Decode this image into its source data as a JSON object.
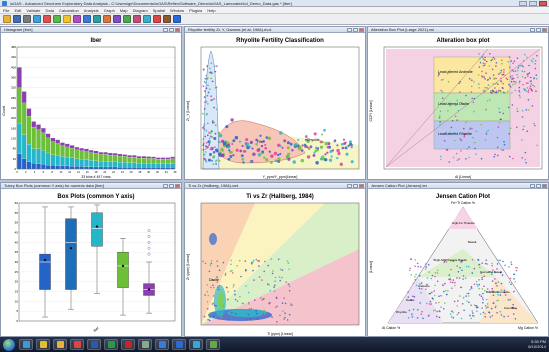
{
  "app": {
    "title": "ioGAS - Advanced Geochem Exploratory Data Analysis - C:\\Users\\ge\\Documents\\ioGAS\\Reflex\\Software_Demo\\ioGAS_Lamorales\\Iol_Demo_Data.gas * [Iber]",
    "menu": [
      "File",
      "Edit",
      "Validate",
      "Data",
      "Calculation",
      "Analysis",
      "Graph",
      "Map",
      "Diagram",
      "Spatial",
      "Window",
      "Plugins",
      "Help"
    ]
  },
  "toolbar": {
    "buttons": [
      {
        "name": "open-icon",
        "color": "#e8b23a"
      },
      {
        "name": "save-icon",
        "color": "#3f6fb5"
      },
      {
        "name": "print-icon",
        "color": "#7a7a7a"
      },
      {
        "name": "table-icon",
        "color": "#3aa0d8"
      },
      {
        "name": "attributes-icon",
        "color": "#e05050"
      },
      {
        "name": "color-icon",
        "color": "#59b84a"
      },
      {
        "name": "shape-icon",
        "color": "#f1c232"
      },
      {
        "name": "size-icon",
        "color": "#b04fc0"
      },
      {
        "name": "histogram-icon",
        "color": "#3a7ad8"
      },
      {
        "name": "scatter-icon",
        "color": "#2aa0a0"
      },
      {
        "name": "boxplot-icon",
        "color": "#d8783a"
      },
      {
        "name": "ternary-icon",
        "color": "#7d4fc0"
      },
      {
        "name": "map-icon",
        "color": "#4fa84f"
      },
      {
        "name": "spider-icon",
        "color": "#c04f7a"
      },
      {
        "name": "diagram-icon",
        "color": "#3ab0c8"
      },
      {
        "name": "probability-icon",
        "color": "#d44"
      },
      {
        "name": "summary-icon",
        "color": "#8a5a2a"
      },
      {
        "name": "info-icon",
        "color": "#2a6ad8"
      }
    ]
  },
  "windows": {
    "histogram": {
      "title": "Histogram [Iber]",
      "chart_title": "Iber",
      "xlabel": "33 bins # 497 rows",
      "ylabel": "Count"
    },
    "rhyolite": {
      "title": "Rhyolite fertility Zr, Y, Gamma (et al, 1984).ev.d",
      "chart_title": "Rhyolite Fertility Classification",
      "xlabel": "Y_ppm/Y_ppm[Linear]",
      "ylabel": "Zr_Y [Linear]",
      "region_label": "Fife",
      "series_label": "Rhyolite"
    },
    "alteration": {
      "title": "Alteration Box Plot (Large 2021).vsl",
      "chart_title": "Alteration box plot",
      "xlabel": "AI [Linear]",
      "ylabel": "CCPI [Linear]",
      "zone_labels": [
        "Least altered Andesite",
        "Least altered Dacite",
        "Least altered Rhyolite"
      ]
    },
    "boxplot": {
      "title": "Tukey Box Plots (common Y axis) for numeric data [Iber]",
      "chart_title": "Box Plots (common Y axis)",
      "category": "Iber"
    },
    "tizr": {
      "title": "Ti vs Zr (Hallberg, 1984).vml",
      "chart_title": "Ti vs Zr (Hallberg, 1984)",
      "xlabel": "Ti (ppm) [Linear]",
      "ylabel": "Zr (ppm) [Linear]",
      "region_label": "Dacite"
    },
    "jensen": {
      "title": "Jensen Cation Plot (Jensen).ter",
      "chart_title": "Jensen Cation Plot",
      "apex_top": "Fe+Ti Cation %",
      "apex_left": "Al Cation %",
      "apex_right": "Mg Cation %",
      "ylabel": "[Linear]",
      "fields": [
        "High-Fe Tholeiite",
        "Basalt",
        "High-Mg Tholeiite Basalt",
        "Andesite",
        "Komatiitic Basalt",
        "Dacite",
        "Basaltic Komatiite",
        "Rhyolite",
        "Komatiite"
      ]
    }
  },
  "chart_data": [
    {
      "type": "bar",
      "name": "histogram",
      "title": "Iber",
      "xlabel": "33 bins # 497 rows",
      "ylabel": "Count",
      "ylim": [
        0,
        480
      ],
      "yticks": [
        0,
        40,
        80,
        120,
        160,
        200,
        240,
        280,
        320,
        360,
        400,
        440,
        480
      ],
      "xticks": [
        "0",
        "2",
        "4",
        "6",
        "8",
        "10",
        "12",
        "14",
        "16",
        "18",
        "20",
        "22",
        "24",
        "26",
        "28",
        "30",
        "32",
        "34",
        "36"
      ],
      "series": [
        {
          "name": "blue",
          "color": "#2563c9",
          "values": [
            60,
            40,
            28,
            22,
            20,
            18,
            15,
            14,
            13,
            12,
            12,
            11,
            10,
            10,
            9,
            9,
            8,
            8,
            8,
            8,
            8,
            7,
            7,
            7,
            7,
            6,
            6,
            6,
            6,
            6,
            6,
            6,
            6
          ]
        },
        {
          "name": "teal",
          "color": "#27b6c9",
          "values": [
            120,
            95,
            70,
            58,
            60,
            55,
            48,
            42,
            40,
            38,
            35,
            33,
            30,
            28,
            28,
            26,
            24,
            22,
            22,
            21,
            20,
            20,
            19,
            18,
            18,
            17,
            17,
            16,
            16,
            15,
            15,
            15,
            15
          ]
        },
        {
          "name": "green",
          "color": "#6dbf3a",
          "values": [
            140,
            125,
            110,
            85,
            75,
            70,
            60,
            52,
            48,
            42,
            40,
            38,
            36,
            34,
            32,
            30,
            30,
            28,
            28,
            26,
            26,
            24,
            24,
            22,
            22,
            20,
            20,
            20,
            20,
            18,
            18,
            18,
            20
          ]
        },
        {
          "name": "purple",
          "color": "#8b3fb0",
          "values": [
            80,
            45,
            30,
            22,
            20,
            18,
            16,
            14,
            14,
            12,
            12,
            11,
            10,
            10,
            10,
            9,
            9,
            8,
            8,
            8,
            8,
            8,
            7,
            7,
            7,
            7,
            7,
            7,
            6,
            6,
            6,
            6,
            7
          ]
        }
      ]
    },
    {
      "type": "box",
      "name": "boxplot",
      "title": "Box Plots (common Y axis)",
      "category": "Iber",
      "ylim": [
        0,
        60
      ],
      "yticks": [
        0,
        5,
        10,
        15,
        20,
        25,
        30,
        35,
        40,
        45,
        50,
        55,
        60
      ],
      "boxes": [
        {
          "color": "#2563c9",
          "min": 2,
          "q1": 16,
          "median": 30,
          "q3": 34,
          "max": 58,
          "mean": 31
        },
        {
          "color": "#1e6fb9",
          "min": 6,
          "q1": 16,
          "median": 40,
          "q3": 52,
          "max": 58,
          "mean": 37
        },
        {
          "color": "#27b6c9",
          "min": 14,
          "q1": 38,
          "median": 47,
          "q3": 55,
          "max": 59,
          "mean": 48
        },
        {
          "color": "#6dbf3a",
          "min": 3,
          "q1": 17,
          "median": 28,
          "q3": 35,
          "max": 42,
          "mean": 28
        },
        {
          "color": "#8b3fb0",
          "min": 4,
          "q1": 13,
          "median": 16,
          "q3": 19,
          "max": 30,
          "mean": 16
        }
      ]
    }
  ],
  "taskbar": {
    "apps": [
      {
        "name": "internet-explorer-icon",
        "color": "#3a9ad8"
      },
      {
        "name": "chrome-icon",
        "color": "#e0c030"
      },
      {
        "name": "folder-icon",
        "color": "#e8b23a"
      },
      {
        "name": "media-icon",
        "color": "#d44"
      },
      {
        "name": "word-icon",
        "color": "#2a5ab0"
      },
      {
        "name": "excel-icon",
        "color": "#2a9a4a"
      },
      {
        "name": "pdf-icon",
        "color": "#c22"
      },
      {
        "name": "paint-icon",
        "color": "#8a8"
      },
      {
        "name": "iogas-icon",
        "color": "#3a7ad8"
      },
      {
        "name": "outlook-icon",
        "color": "#2a6ad8"
      },
      {
        "name": "skype-icon",
        "color": "#30a8e0"
      },
      {
        "name": "app-icon",
        "color": "#6a4"
      }
    ],
    "time": "5:30 PM",
    "date": "6/10/2014"
  }
}
